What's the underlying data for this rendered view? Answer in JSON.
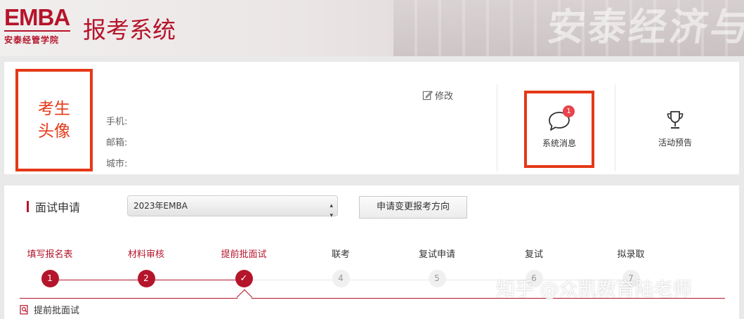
{
  "header": {
    "logo_main": "EMBA",
    "logo_sub": "安泰经管学院",
    "title": "报考系统",
    "background_text": "安泰经济与"
  },
  "profile": {
    "avatar_label": "考生头像",
    "fields": [
      {
        "label": "手机:",
        "value": ""
      },
      {
        "label": "邮箱:",
        "value": ""
      },
      {
        "label": "城市:",
        "value": ""
      }
    ],
    "edit_label": "修改",
    "messages": {
      "label": "系统消息",
      "badge": "1"
    },
    "events": {
      "label": "活动预告"
    }
  },
  "application": {
    "section_title": "面试申请",
    "program_select": {
      "value": "2023年EMBA"
    },
    "change_button": "申请变更报考方向",
    "steps": [
      {
        "label": "填写报名表",
        "marker": "1",
        "status": "done"
      },
      {
        "label": "材料审核",
        "marker": "2",
        "status": "done"
      },
      {
        "label": "提前批面试",
        "marker": "✓",
        "status": "current"
      },
      {
        "label": "联考",
        "marker": "4",
        "status": "todo"
      },
      {
        "label": "复试申请",
        "marker": "5",
        "status": "todo"
      },
      {
        "label": "复试",
        "marker": "6",
        "status": "todo"
      },
      {
        "label": "拟录取",
        "marker": "7",
        "status": "todo"
      }
    ],
    "current_section_title": "提前批面试"
  },
  "watermark": "知乎 @众凯教育陆老师",
  "colors": {
    "brand": "#b5152b",
    "highlight_box": "#e53817",
    "badge": "#e8434b"
  }
}
